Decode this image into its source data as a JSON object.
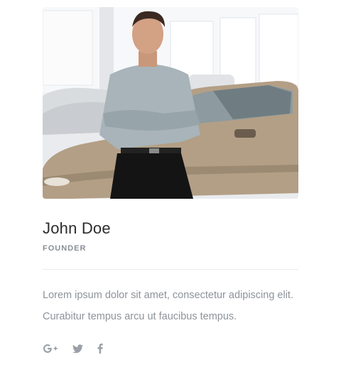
{
  "profile": {
    "name": "John Doe",
    "role": "FOUNDER",
    "bio": "Lorem ipsum dolor sit amet, consectetur adipiscing elit. Curabitur tempus arcu ut faucibus tempus.",
    "photo_alt": "Man in car showroom"
  },
  "social": [
    {
      "icon": "google-plus-icon",
      "label": "G+"
    },
    {
      "icon": "twitter-icon",
      "label": "Twitter"
    },
    {
      "icon": "facebook-icon",
      "label": "Facebook"
    }
  ],
  "colors": {
    "name": "#2c2c2c",
    "role": "#8a8f96",
    "bio": "#8e9399",
    "icon": "#9aa0a6",
    "divider": "#e8eaed"
  }
}
